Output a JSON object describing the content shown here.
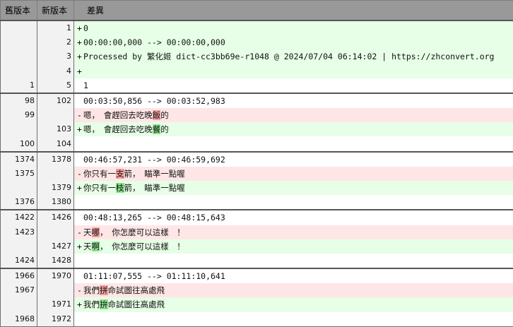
{
  "header": {
    "old_label": "舊版本",
    "new_label": "新版本",
    "diff_label": "差異"
  },
  "colors": {
    "added_bg": "#e6ffe6",
    "removed_bg": "#ffe6e6",
    "added_highlight": "#8fe08f",
    "removed_highlight": "#f2a0a0",
    "header_bg": "#999999"
  },
  "groups": [
    {
      "rows": [
        {
          "old": "",
          "new": "1",
          "kind": "add",
          "marker": "+",
          "text": "0"
        },
        {
          "old": "",
          "new": "2",
          "kind": "add",
          "marker": "+",
          "text": "00:00:00,000 --> 00:00:00,000"
        },
        {
          "old": "",
          "new": "3",
          "kind": "add",
          "marker": "+",
          "text": "Processed by 繁化姬 dict-cc3bb69e-r1048 @ 2024/07/04 06:14:02 | https://zhconvert.org"
        },
        {
          "old": "",
          "new": "4",
          "kind": "add",
          "marker": "+",
          "text": ""
        },
        {
          "old": "1",
          "new": "5",
          "kind": "ctx",
          "marker": " ",
          "text": "1"
        }
      ]
    },
    {
      "rows": [
        {
          "old": "98",
          "new": "102",
          "kind": "ctx",
          "marker": " ",
          "text": "00:03:50,856 --> 00:03:52,983"
        },
        {
          "old": "99",
          "new": "",
          "kind": "del",
          "marker": "-",
          "pre": "嗯，　會趕回去吃晚",
          "hl": "飯",
          "post": "的"
        },
        {
          "old": "",
          "new": "103",
          "kind": "add",
          "marker": "+",
          "pre": "嗯，　會趕回去吃晚",
          "hl": "餐",
          "post": "的"
        },
        {
          "old": "100",
          "new": "104",
          "kind": "ctx",
          "marker": " ",
          "text": ""
        }
      ]
    },
    {
      "rows": [
        {
          "old": "1374",
          "new": "1378",
          "kind": "ctx",
          "marker": " ",
          "text": "00:46:57,231 --> 00:46:59,692"
        },
        {
          "old": "1375",
          "new": "",
          "kind": "del",
          "marker": "-",
          "pre": "你只有一",
          "hl": "支",
          "post": "箭，　瞄準一點喔"
        },
        {
          "old": "",
          "new": "1379",
          "kind": "add",
          "marker": "+",
          "pre": "你只有一",
          "hl": "枝",
          "post": "箭，　瞄準一點喔"
        },
        {
          "old": "1376",
          "new": "1380",
          "kind": "ctx",
          "marker": " ",
          "text": ""
        }
      ]
    },
    {
      "rows": [
        {
          "old": "1422",
          "new": "1426",
          "kind": "ctx",
          "marker": " ",
          "text": "00:48:13,265 --> 00:48:15,643"
        },
        {
          "old": "1423",
          "new": "",
          "kind": "del",
          "marker": "-",
          "pre": "天",
          "hl": "哪",
          "post": "，　你怎麼可以這樣　！"
        },
        {
          "old": "",
          "new": "1427",
          "kind": "add",
          "marker": "+",
          "pre": "天",
          "hl": "啊",
          "post": "，　你怎麼可以這樣　！"
        },
        {
          "old": "1424",
          "new": "1428",
          "kind": "ctx",
          "marker": " ",
          "text": ""
        }
      ]
    },
    {
      "rows": [
        {
          "old": "1966",
          "new": "1970",
          "kind": "ctx",
          "marker": " ",
          "text": "01:11:07,555 --> 01:11:10,641"
        },
        {
          "old": "1967",
          "new": "",
          "kind": "del",
          "marker": "-",
          "pre": "我們",
          "hl": "拼",
          "post": "命試圖往高處飛"
        },
        {
          "old": "",
          "new": "1971",
          "kind": "add",
          "marker": "+",
          "pre": "我們",
          "hl": "拚",
          "post": "命試圖往高處飛"
        },
        {
          "old": "1968",
          "new": "1972",
          "kind": "ctx",
          "marker": " ",
          "text": ""
        }
      ]
    }
  ]
}
